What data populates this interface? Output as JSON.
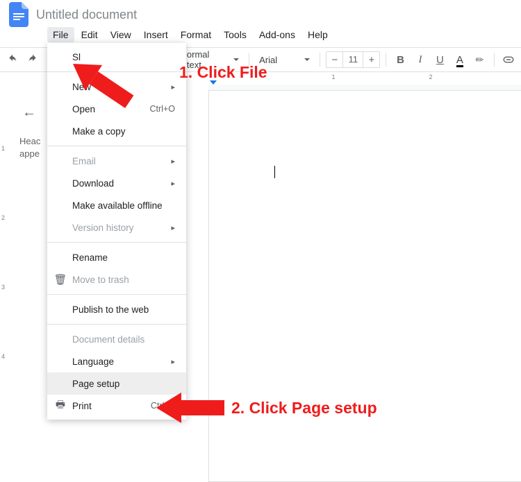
{
  "title": "Untitled document",
  "menu": {
    "file": "File",
    "edit": "Edit",
    "view": "View",
    "insert": "Insert",
    "format": "Format",
    "tools": "Tools",
    "addons": "Add-ons",
    "help": "Help"
  },
  "toolbar": {
    "style_label": "ormal text",
    "font_label": "Arial",
    "font_size": "11",
    "minus": "−",
    "plus": "+",
    "bold": "B",
    "italic": "I",
    "underline": "U",
    "textcolor": "A"
  },
  "outline": {
    "back": "←",
    "text": "Heac\nappe"
  },
  "file_menu": {
    "share": "Sl",
    "new": "New",
    "open": "Open",
    "open_sc": "Ctrl+O",
    "copy": "Make a copy",
    "email": "Email",
    "download": "Download",
    "offline": "Make available offline",
    "version": "Version history",
    "rename": "Rename",
    "trash": "Move to trash",
    "publish": "Publish to the web",
    "details": "Document details",
    "language": "Language",
    "pagesetup": "Page setup",
    "print": "Print",
    "print_sc": "Ctrl+P",
    "arrow": "▸"
  },
  "ruler": {
    "h1": "1",
    "h2": "2",
    "v1": "1",
    "v2": "2",
    "v3": "3",
    "v4": "4"
  },
  "annotations": {
    "a1": "1. Click File",
    "a2": "2. Click Page setup"
  }
}
